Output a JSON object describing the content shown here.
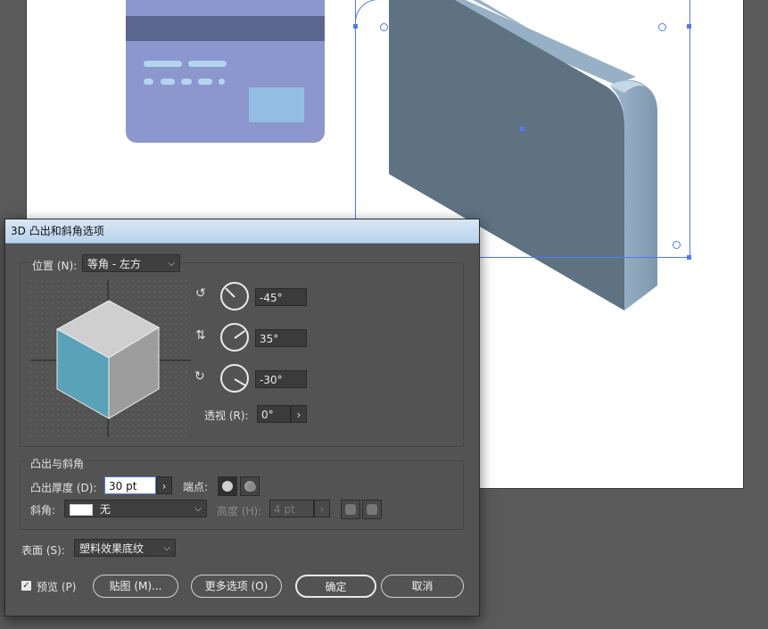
{
  "dialog": {
    "title": "3D 凸出和斜角选项",
    "position_label": "位置 (N):",
    "position_value": "等角 - 左方",
    "rotation": {
      "x_angle": "-45°",
      "y_angle": "35°",
      "z_angle": "-30°"
    },
    "perspective_label": "透视 (R):",
    "perspective_value": "0°",
    "extrude_section_title": "凸出与斜角",
    "extrude_depth_label": "凸出厚度 (D):",
    "extrude_depth_value": "30 pt",
    "cap_label": "端点:",
    "bevel_label": "斜角:",
    "bevel_value": "无",
    "height_label": "高度 (H):",
    "height_value": "4 pt",
    "surface_label": "表面 (S):",
    "surface_value": "塑料效果底纹",
    "preview_label": "预览 (P)",
    "preview_checked": true,
    "map_button": "贴图 (M)...",
    "more_options_button": "更多选项 (O)",
    "ok_button": "确定",
    "cancel_button": "取消"
  },
  "colors": {
    "dialog_bg": "#535353",
    "titlebar": "#c8dcf0",
    "selection": "#4f7bea",
    "card": "#8b97cd",
    "extrusion_front": "#5f7282",
    "extrusion_side": "#8fa7bd",
    "cube_left": "#5aa2b8"
  },
  "icons": [
    "x-axis-rotate-icon",
    "y-axis-rotate-icon",
    "z-axis-rotate-icon",
    "cap-on-icon",
    "cap-off-icon",
    "bevel-extent-in-icon",
    "bevel-extent-out-icon",
    "chevron-down-icon",
    "arrow-right-icon"
  ]
}
